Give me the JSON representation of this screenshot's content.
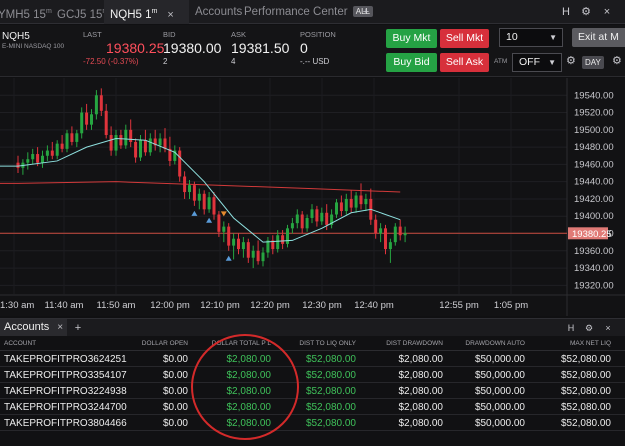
{
  "tabs": [
    {
      "label": "YMH5",
      "tf": "15",
      "unit": "m"
    },
    {
      "label": "GCJ5",
      "tf": "15",
      "unit": "m"
    },
    {
      "label": "NQH5",
      "tf": "1",
      "unit": "m",
      "active": true
    },
    {
      "label": "Accounts"
    },
    {
      "label": "Performance Center",
      "badge": "ALL"
    }
  ],
  "tab_icons": {
    "close": "×",
    "add": "+",
    "help": "H",
    "settings": "⚙",
    "close_window": "×"
  },
  "quote": {
    "symbol": "NQH5",
    "description": "E-MINI NASDAQ 100",
    "last_label": "LAST",
    "last": "19380.25",
    "change": "-72.50 (-0.37%)",
    "bid_label": "BID",
    "bid": "19380.00",
    "bid_size": "2",
    "ask_label": "ASK",
    "ask": "19381.50",
    "ask_size": "4",
    "position_label": "POSITION",
    "position": "0",
    "position_sub": "-.-- USD"
  },
  "order": {
    "buy_mkt": "Buy Mkt",
    "sell_mkt": "Sell Mkt",
    "buy_bid": "Buy Bid",
    "sell_ask": "Sell Ask",
    "quantity": "10",
    "exit": "Exit at M",
    "atm_label": "ATM",
    "atm_value": "OFF",
    "day": "DAY"
  },
  "colors": {
    "up": "#26a641",
    "down": "#e0343c",
    "ma_fast": "#8ee0df",
    "ma_slow": "#d13a3a",
    "last_line": "#c84a3e"
  },
  "chart_data": {
    "type": "candlestick",
    "symbol": "NQH5",
    "interval": "1m",
    "ylim": [
      19310,
      19560
    ],
    "yticks": [
      19320,
      19340,
      19360,
      19380,
      19400,
      19420,
      19440,
      19460,
      19480,
      19500,
      19520,
      19540
    ],
    "x_labels": [
      "1:30 am",
      "11:40 am",
      "11:50 am",
      "12:00 pm",
      "12:10 pm",
      "12:20 pm",
      "12:30 pm",
      "12:40 pm",
      "12:55 pm",
      "1:05 pm"
    ],
    "last_price_label": "19380.25",
    "last_price": 19380.25,
    "candles": [
      {
        "o": 19462,
        "h": 19470,
        "l": 19450,
        "c": 19456
      },
      {
        "o": 19456,
        "h": 19466,
        "l": 19448,
        "c": 19462
      },
      {
        "o": 19462,
        "h": 19474,
        "l": 19454,
        "c": 19466
      },
      {
        "o": 19466,
        "h": 19478,
        "l": 19460,
        "c": 19472
      },
      {
        "o": 19472,
        "h": 19480,
        "l": 19458,
        "c": 19462
      },
      {
        "o": 19462,
        "h": 19476,
        "l": 19456,
        "c": 19470
      },
      {
        "o": 19470,
        "h": 19482,
        "l": 19464,
        "c": 19476
      },
      {
        "o": 19476,
        "h": 19486,
        "l": 19466,
        "c": 19470
      },
      {
        "o": 19470,
        "h": 19488,
        "l": 19466,
        "c": 19484
      },
      {
        "o": 19484,
        "h": 19494,
        "l": 19474,
        "c": 19478
      },
      {
        "o": 19478,
        "h": 19500,
        "l": 19474,
        "c": 19496
      },
      {
        "o": 19496,
        "h": 19504,
        "l": 19482,
        "c": 19486
      },
      {
        "o": 19486,
        "h": 19500,
        "l": 19480,
        "c": 19496
      },
      {
        "o": 19496,
        "h": 19526,
        "l": 19490,
        "c": 19520
      },
      {
        "o": 19520,
        "h": 19530,
        "l": 19500,
        "c": 19506
      },
      {
        "o": 19506,
        "h": 19524,
        "l": 19500,
        "c": 19518
      },
      {
        "o": 19518,
        "h": 19546,
        "l": 19512,
        "c": 19540
      },
      {
        "o": 19540,
        "h": 19548,
        "l": 19516,
        "c": 19522
      },
      {
        "o": 19522,
        "h": 19530,
        "l": 19490,
        "c": 19494
      },
      {
        "o": 19494,
        "h": 19504,
        "l": 19470,
        "c": 19476
      },
      {
        "o": 19476,
        "h": 19500,
        "l": 19470,
        "c": 19494
      },
      {
        "o": 19494,
        "h": 19500,
        "l": 19478,
        "c": 19482
      },
      {
        "o": 19482,
        "h": 19506,
        "l": 19478,
        "c": 19500
      },
      {
        "o": 19500,
        "h": 19512,
        "l": 19480,
        "c": 19486
      },
      {
        "o": 19486,
        "h": 19490,
        "l": 19462,
        "c": 19468
      },
      {
        "o": 19468,
        "h": 19494,
        "l": 19464,
        "c": 19488
      },
      {
        "o": 19488,
        "h": 19500,
        "l": 19470,
        "c": 19474
      },
      {
        "o": 19474,
        "h": 19496,
        "l": 19470,
        "c": 19490
      },
      {
        "o": 19490,
        "h": 19500,
        "l": 19476,
        "c": 19482
      },
      {
        "o": 19482,
        "h": 19496,
        "l": 19474,
        "c": 19490
      },
      {
        "o": 19490,
        "h": 19502,
        "l": 19474,
        "c": 19478
      },
      {
        "o": 19478,
        "h": 19492,
        "l": 19458,
        "c": 19464
      },
      {
        "o": 19464,
        "h": 19482,
        "l": 19460,
        "c": 19476
      },
      {
        "o": 19476,
        "h": 19480,
        "l": 19440,
        "c": 19446
      },
      {
        "o": 19446,
        "h": 19452,
        "l": 19420,
        "c": 19428
      },
      {
        "o": 19428,
        "h": 19442,
        "l": 19420,
        "c": 19436
      },
      {
        "o": 19436,
        "h": 19440,
        "l": 19412,
        "c": 19418
      },
      {
        "o": 19418,
        "h": 19432,
        "l": 19408,
        "c": 19426
      },
      {
        "o": 19426,
        "h": 19430,
        "l": 19402,
        "c": 19408
      },
      {
        "o": 19408,
        "h": 19428,
        "l": 19404,
        "c": 19422
      },
      {
        "o": 19422,
        "h": 19428,
        "l": 19396,
        "c": 19402
      },
      {
        "o": 19402,
        "h": 19406,
        "l": 19376,
        "c": 19382
      },
      {
        "o": 19382,
        "h": 19394,
        "l": 19370,
        "c": 19388
      },
      {
        "o": 19388,
        "h": 19392,
        "l": 19360,
        "c": 19366
      },
      {
        "o": 19366,
        "h": 19380,
        "l": 19350,
        "c": 19374
      },
      {
        "o": 19374,
        "h": 19380,
        "l": 19356,
        "c": 19362
      },
      {
        "o": 19362,
        "h": 19376,
        "l": 19352,
        "c": 19370
      },
      {
        "o": 19370,
        "h": 19374,
        "l": 19346,
        "c": 19352
      },
      {
        "o": 19352,
        "h": 19366,
        "l": 19340,
        "c": 19360
      },
      {
        "o": 19360,
        "h": 19372,
        "l": 19344,
        "c": 19348
      },
      {
        "o": 19348,
        "h": 19364,
        "l": 19342,
        "c": 19358
      },
      {
        "o": 19358,
        "h": 19376,
        "l": 19352,
        "c": 19372
      },
      {
        "o": 19372,
        "h": 19378,
        "l": 19356,
        "c": 19362
      },
      {
        "o": 19362,
        "h": 19384,
        "l": 19358,
        "c": 19378
      },
      {
        "o": 19378,
        "h": 19384,
        "l": 19362,
        "c": 19368
      },
      {
        "o": 19368,
        "h": 19390,
        "l": 19364,
        "c": 19386
      },
      {
        "o": 19386,
        "h": 19398,
        "l": 19380,
        "c": 19392
      },
      {
        "o": 19392,
        "h": 19408,
        "l": 19386,
        "c": 19402
      },
      {
        "o": 19402,
        "h": 19406,
        "l": 19380,
        "c": 19386
      },
      {
        "o": 19386,
        "h": 19402,
        "l": 19382,
        "c": 19398
      },
      {
        "o": 19398,
        "h": 19414,
        "l": 19392,
        "c": 19408
      },
      {
        "o": 19408,
        "h": 19412,
        "l": 19388,
        "c": 19394
      },
      {
        "o": 19394,
        "h": 19410,
        "l": 19390,
        "c": 19404
      },
      {
        "o": 19404,
        "h": 19414,
        "l": 19384,
        "c": 19390
      },
      {
        "o": 19390,
        "h": 19408,
        "l": 19386,
        "c": 19402
      },
      {
        "o": 19402,
        "h": 19420,
        "l": 19398,
        "c": 19416
      },
      {
        "o": 19416,
        "h": 19424,
        "l": 19400,
        "c": 19406
      },
      {
        "o": 19406,
        "h": 19426,
        "l": 19402,
        "c": 19420
      },
      {
        "o": 19420,
        "h": 19430,
        "l": 19404,
        "c": 19410
      },
      {
        "o": 19410,
        "h": 19428,
        "l": 19404,
        "c": 19424
      },
      {
        "o": 19424,
        "h": 19438,
        "l": 19408,
        "c": 19414
      },
      {
        "o": 19414,
        "h": 19426,
        "l": 19406,
        "c": 19420
      },
      {
        "o": 19420,
        "h": 19432,
        "l": 19390,
        "c": 19396
      },
      {
        "o": 19396,
        "h": 19402,
        "l": 19374,
        "c": 19380
      },
      {
        "o": 19380,
        "h": 19392,
        "l": 19370,
        "c": 19386
      },
      {
        "o": 19386,
        "h": 19390,
        "l": 19356,
        "c": 19362
      },
      {
        "o": 19362,
        "h": 19374,
        "l": 19346,
        "c": 19370
      },
      {
        "o": 19370,
        "h": 19392,
        "l": 19366,
        "c": 19388
      },
      {
        "o": 19388,
        "h": 19396,
        "l": 19372,
        "c": 19378
      },
      {
        "o": 19378,
        "h": 19388,
        "l": 19370,
        "c": 19380.25
      }
    ],
    "ma_fast": [
      {
        "i": 0,
        "v": 19458
      },
      {
        "i": 8,
        "v": 19464
      },
      {
        "i": 14,
        "v": 19480
      },
      {
        "i": 20,
        "v": 19490
      },
      {
        "i": 26,
        "v": 19488
      },
      {
        "i": 32,
        "v": 19474
      },
      {
        "i": 38,
        "v": 19440
      },
      {
        "i": 44,
        "v": 19398
      },
      {
        "i": 50,
        "v": 19370
      },
      {
        "i": 56,
        "v": 19372
      },
      {
        "i": 62,
        "v": 19386
      },
      {
        "i": 68,
        "v": 19404
      },
      {
        "i": 72,
        "v": 19408
      },
      {
        "i": 78,
        "v": 19396
      }
    ],
    "ma_slow": [
      {
        "i": 0,
        "v": 19438
      },
      {
        "i": 20,
        "v": 19440
      },
      {
        "i": 40,
        "v": 19436
      },
      {
        "i": 60,
        "v": 19432
      },
      {
        "i": 78,
        "v": 19428
      }
    ],
    "markers": [
      {
        "i": 36,
        "dir": "buy"
      },
      {
        "i": 39,
        "dir": "buy"
      },
      {
        "i": 42,
        "dir": "sell"
      },
      {
        "i": 43,
        "dir": "buy"
      }
    ]
  },
  "accounts_panel": {
    "tab_label": "Accounts",
    "columns": [
      "ACCOUNT",
      "DOLLAR OPEN",
      "DOLLAR TOTAL P L",
      "DIST TO LIQ ONLY",
      "DIST DRAWDOWN",
      "DRAWDOWN AUTO",
      "MAX NET LIQ"
    ],
    "rows": [
      [
        "TAKEPROFITPRO3624251",
        "$0.00",
        "$2,080.00",
        "$52,080.00",
        "$2,080.00",
        "$50,000.00",
        "$52,080.00"
      ],
      [
        "TAKEPROFITPRO3354107",
        "$0.00",
        "$2,080.00",
        "$52,080.00",
        "$2,080.00",
        "$50,000.00",
        "$52,080.00"
      ],
      [
        "TAKEPROFITPRO3224938",
        "$0.00",
        "$2,080.00",
        "$52,080.00",
        "$2,080.00",
        "$50,000.00",
        "$52,080.00"
      ],
      [
        "TAKEPROFITPRO3244700",
        "$0.00",
        "$2,080.00",
        "$52,080.00",
        "$2,080.00",
        "$50,000.00",
        "$52,080.00"
      ],
      [
        "TAKEPROFITPRO3804466",
        "$0.00",
        "$2,080.00",
        "$52,080.00",
        "$2,080.00",
        "$50,000.00",
        "$52,080.00"
      ]
    ]
  }
}
